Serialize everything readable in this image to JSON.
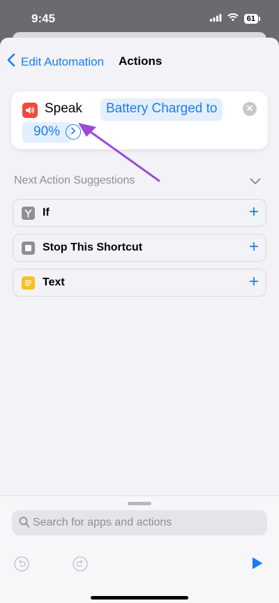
{
  "status": {
    "time": "9:45",
    "battery": "61"
  },
  "nav": {
    "back_label": "Edit Automation",
    "title": "Actions"
  },
  "action": {
    "name": "Speak",
    "param_line1": "Battery Charged to",
    "param_line2": "90%"
  },
  "suggestions": {
    "title": "Next Action Suggestions",
    "items": [
      {
        "label": "If",
        "icon": "if-icon",
        "color": "#8e8e93"
      },
      {
        "label": "Stop This Shortcut",
        "icon": "stop-icon",
        "color": "#8e8e93"
      },
      {
        "label": "Text",
        "icon": "text-icon",
        "color": "#f7c21b"
      }
    ]
  },
  "search": {
    "placeholder": "Search for apps and actions"
  },
  "colors": {
    "accent": "#1a7cf5",
    "speak_icon": "#ef4a3f",
    "annotation_arrow": "#9b4bd8"
  }
}
